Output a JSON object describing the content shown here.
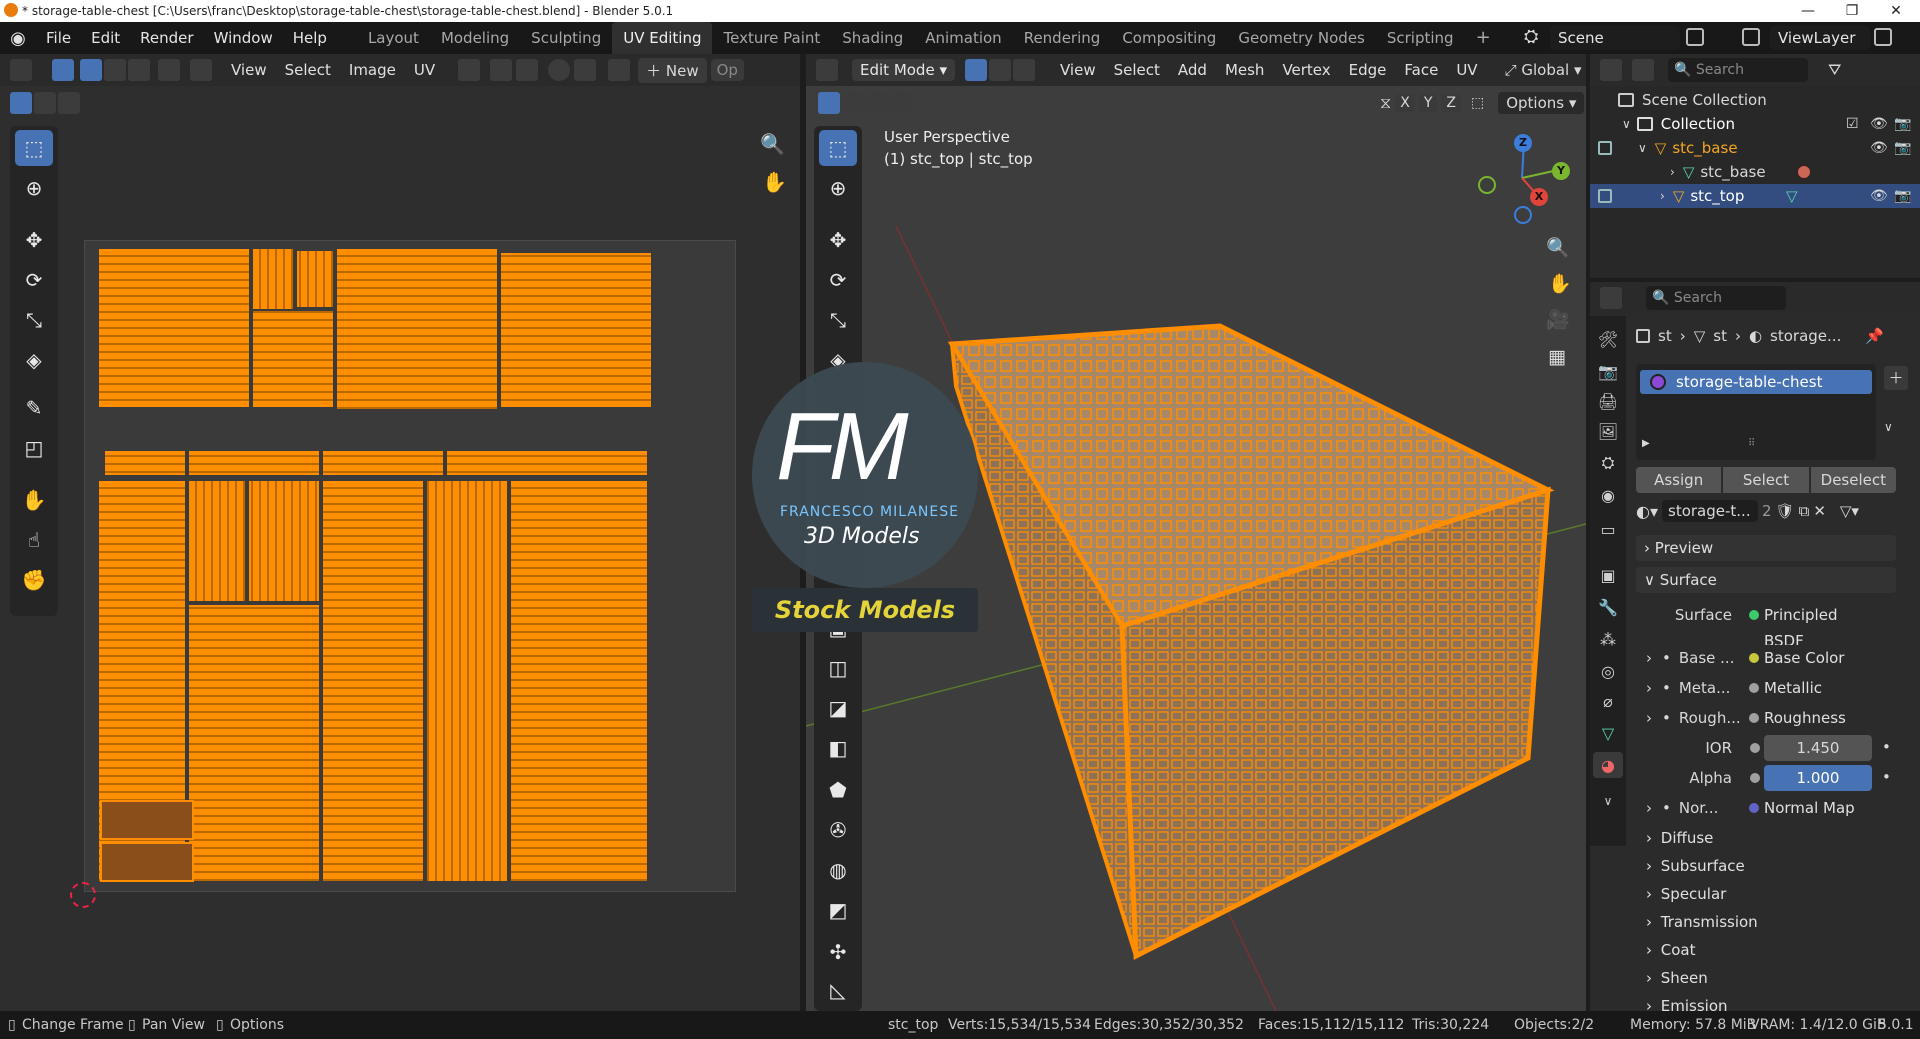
{
  "window": {
    "title": "* storage-table-chest [C:\\Users\\franc\\Desktop\\storage-table-chest\\storage-table-chest.blend] - Blender 5.0.1",
    "minimize": "—",
    "maximize": "❐",
    "close": "✕"
  },
  "menubar": {
    "items": [
      "File",
      "Edit",
      "Render",
      "Window",
      "Help"
    ],
    "workspaces": [
      "Layout",
      "Modeling",
      "Sculpting",
      "UV Editing",
      "Texture Paint",
      "Shading",
      "Animation",
      "Rendering",
      "Compositing",
      "Geometry Nodes",
      "Scripting"
    ],
    "active_workspace": "UV Editing",
    "add_workspace": "+",
    "scene": "Scene",
    "view_layer": "ViewLayer"
  },
  "uv_editor": {
    "menus": [
      "View",
      "Select",
      "Image",
      "UV"
    ],
    "new_label": "New",
    "open_label": "Op",
    "tools": [
      "select-box-icon",
      "cursor-icon",
      "move-icon",
      "rotate-icon",
      "scale-icon",
      "transform-icon",
      "annotate-icon",
      "rip-icon",
      "grab-icon",
      "relax-icon",
      "pinch-icon"
    ]
  },
  "viewport": {
    "mode": "Edit Mode",
    "menus": [
      "View",
      "Select",
      "Add",
      "Mesh",
      "Vertex",
      "Edge",
      "Face",
      "UV"
    ],
    "orientation": "Global",
    "axes": [
      "X",
      "Y",
      "Z"
    ],
    "options_label": "Options",
    "overlay_line1": "User Perspective",
    "overlay_line2": "(1) stc_top | stc_top",
    "gizmo": {
      "x": "X",
      "y": "Y",
      "z": "Z"
    }
  },
  "watermark": {
    "logo": "FM",
    "author": "FRANCESCO MILANESE",
    "subtitle": "3D Models",
    "badge": "Stock Models"
  },
  "outliner": {
    "search_placeholder": "Search",
    "rows": [
      {
        "label": "Scene Collection",
        "indent": 0
      },
      {
        "label": "Collection",
        "indent": 1
      },
      {
        "label": "stc_base",
        "indent": 2
      },
      {
        "label": "stc_base",
        "indent": 3
      },
      {
        "label": "stc_top",
        "indent": 2
      }
    ]
  },
  "properties": {
    "search_placeholder": "Search",
    "breadcrumb": [
      "st",
      "st",
      "storage..."
    ],
    "material_slot": "storage-table-chest",
    "assign": "Assign",
    "select": "Select",
    "deselect": "Deselect",
    "material_name": "storage-t...",
    "user_count": "2",
    "sections_top": [
      "Preview",
      "Surface"
    ],
    "surface_label": "Surface",
    "surface_value": "Principled BSDF",
    "inputs": [
      {
        "label": "Base ...",
        "value": "Base Color",
        "color": "#c8c83c"
      },
      {
        "label": "Meta...",
        "value": "Metallic",
        "color": "#a0a0a0"
      },
      {
        "label": "Rough...",
        "value": "Roughness",
        "color": "#a0a0a0"
      },
      {
        "label": "IOR",
        "value": "1.450",
        "color": "#a0a0a0"
      },
      {
        "label": "Alpha",
        "value": "1.000",
        "color": "#a0a0a0"
      },
      {
        "label": "Nor...",
        "value": "Normal Map",
        "color": "#6363c7"
      }
    ],
    "subsections": [
      "Diffuse",
      "Subsurface",
      "Specular",
      "Transmission",
      "Coat",
      "Sheen",
      "Emission"
    ]
  },
  "statusbar": {
    "change_frame": "Change Frame",
    "pan_view": "Pan View",
    "options": "Options",
    "object": "stc_top",
    "verts": "Verts:15,534/15,534",
    "edges": "Edges:30,352/30,352",
    "faces": "Faces:15,112/15,112",
    "tris": "Tris:30,224",
    "objects": "Objects:2/2",
    "memory": "Memory: 57.8 MiB",
    "vram": "VRAM: 1.4/12.0 GiB",
    "version": "5.0.1"
  },
  "colors": {
    "accent": "#4772b3",
    "selection": "#ff8d00",
    "header": "#2a2a2a",
    "panel": "#303030"
  }
}
